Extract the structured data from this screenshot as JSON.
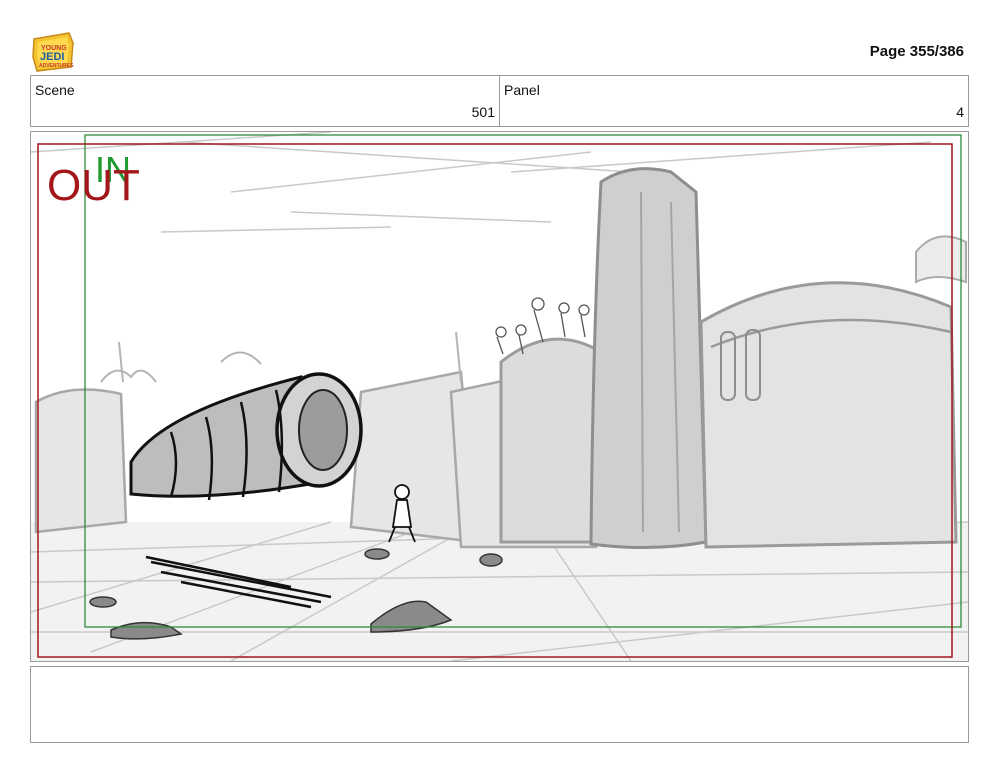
{
  "header": {
    "logo_alt": "Young Jedi Adventures",
    "page_label": "Page 355/386"
  },
  "fields": {
    "scene_label": "Scene",
    "scene_value": "501",
    "panel_label": "Panel",
    "panel_value": "4"
  },
  "panel": {
    "safe_in_label": "IN",
    "safe_out_label": "OUT",
    "in_color": "#1f9a2f",
    "out_color": "#a3161a"
  },
  "notes": {
    "text": ""
  }
}
